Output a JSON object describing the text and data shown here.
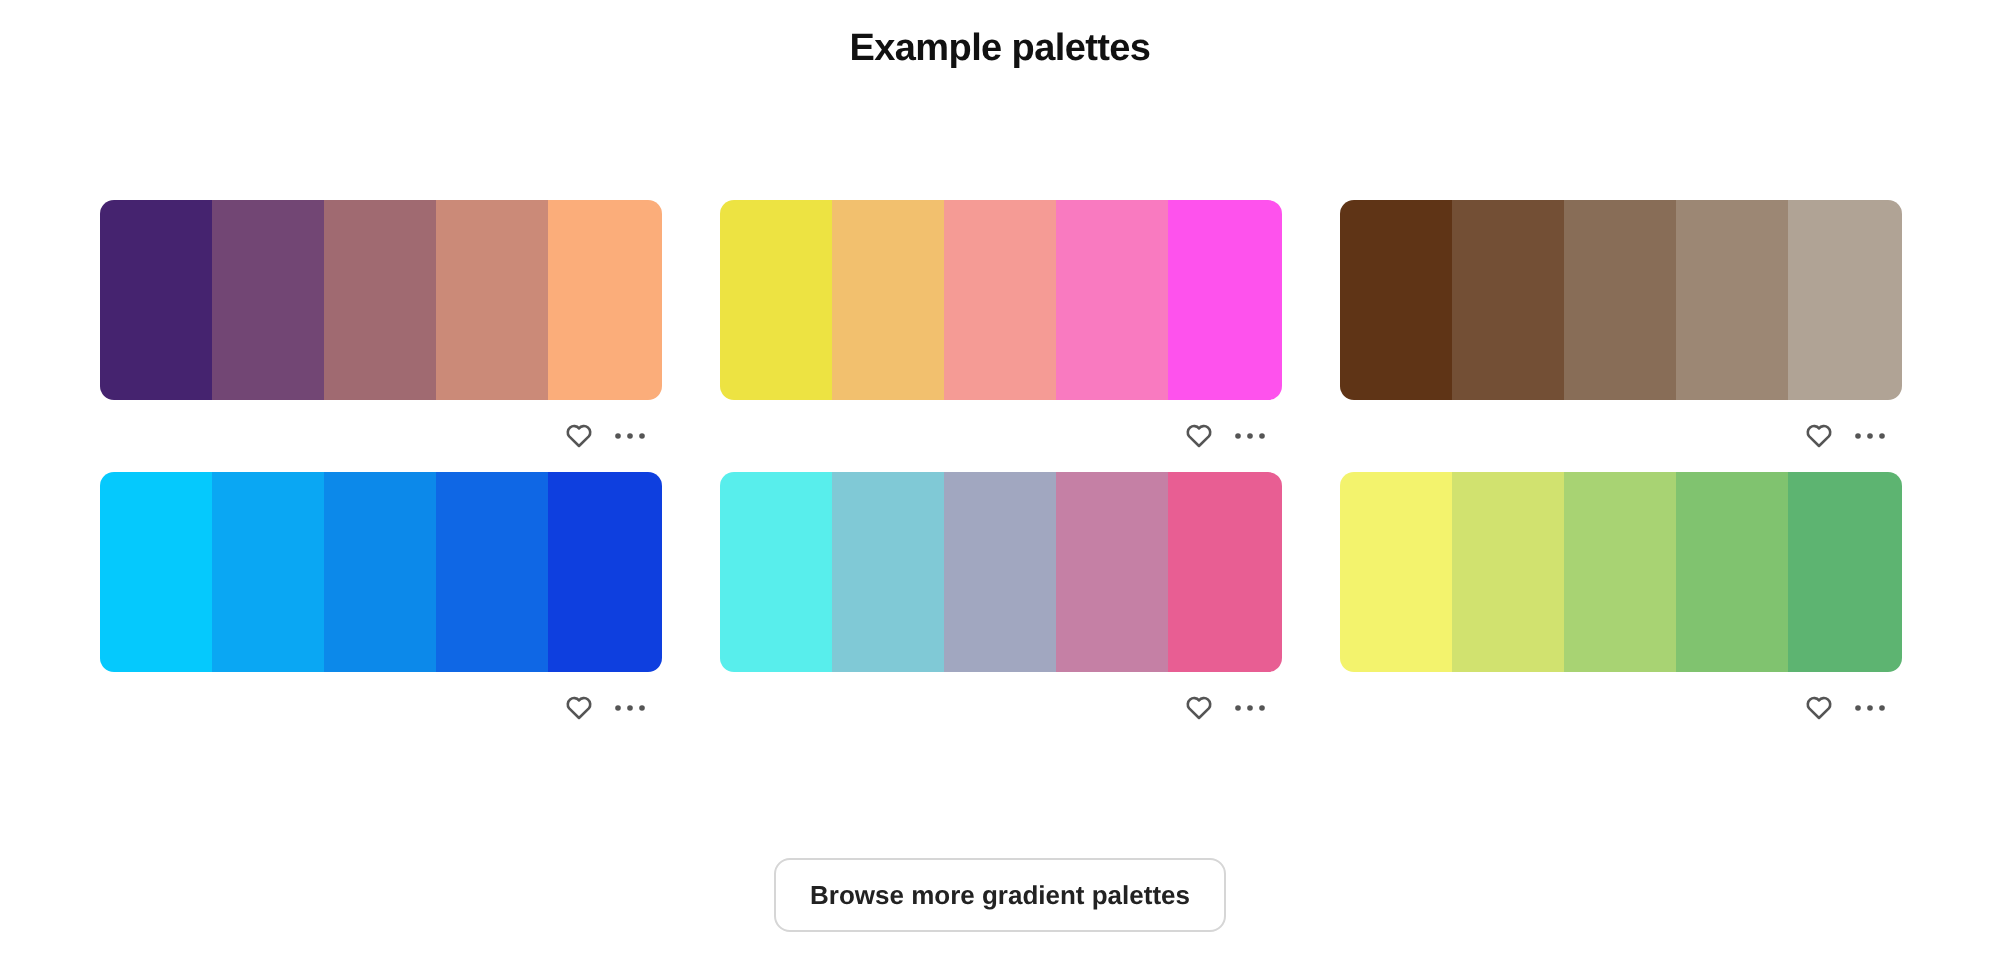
{
  "title": "Example palettes",
  "palettes": [
    {
      "swatches": [
        {
          "color": "#45236f"
        },
        {
          "color": "#724674"
        },
        {
          "color": "#a06a71"
        },
        {
          "color": "#cb8a78"
        },
        {
          "color": "#fbad7a"
        }
      ]
    },
    {
      "swatches": [
        {
          "color": "#ede342"
        },
        {
          "color": "#f2c06e"
        },
        {
          "color": "#f59b95"
        },
        {
          "color": "#f97ac0"
        },
        {
          "color": "#fe52ed"
        }
      ]
    },
    {
      "swatches": [
        {
          "color": "#5f3416"
        },
        {
          "color": "#734f35"
        },
        {
          "color": "#886d57"
        },
        {
          "color": "#9c8774"
        },
        {
          "color": "#b0a395"
        }
      ]
    },
    {
      "swatches": [
        {
          "color": "#05c9fd"
        },
        {
          "color": "#0aa7f3"
        },
        {
          "color": "#0c89ea"
        },
        {
          "color": "#0f67e5"
        },
        {
          "color": "#0e3fdf"
        }
      ]
    },
    {
      "swatches": [
        {
          "color": "#58eeec"
        },
        {
          "color": "#80c9d6"
        },
        {
          "color": "#a1a7c0"
        },
        {
          "color": "#c580a5"
        },
        {
          "color": "#e85e93"
        }
      ]
    },
    {
      "swatches": [
        {
          "color": "#f3f36d"
        },
        {
          "color": "#d1e26f"
        },
        {
          "color": "#a8d373"
        },
        {
          "color": "#80c36f"
        },
        {
          "color": "#5db471"
        }
      ]
    }
  ],
  "button": "Browse more gradient palettes"
}
